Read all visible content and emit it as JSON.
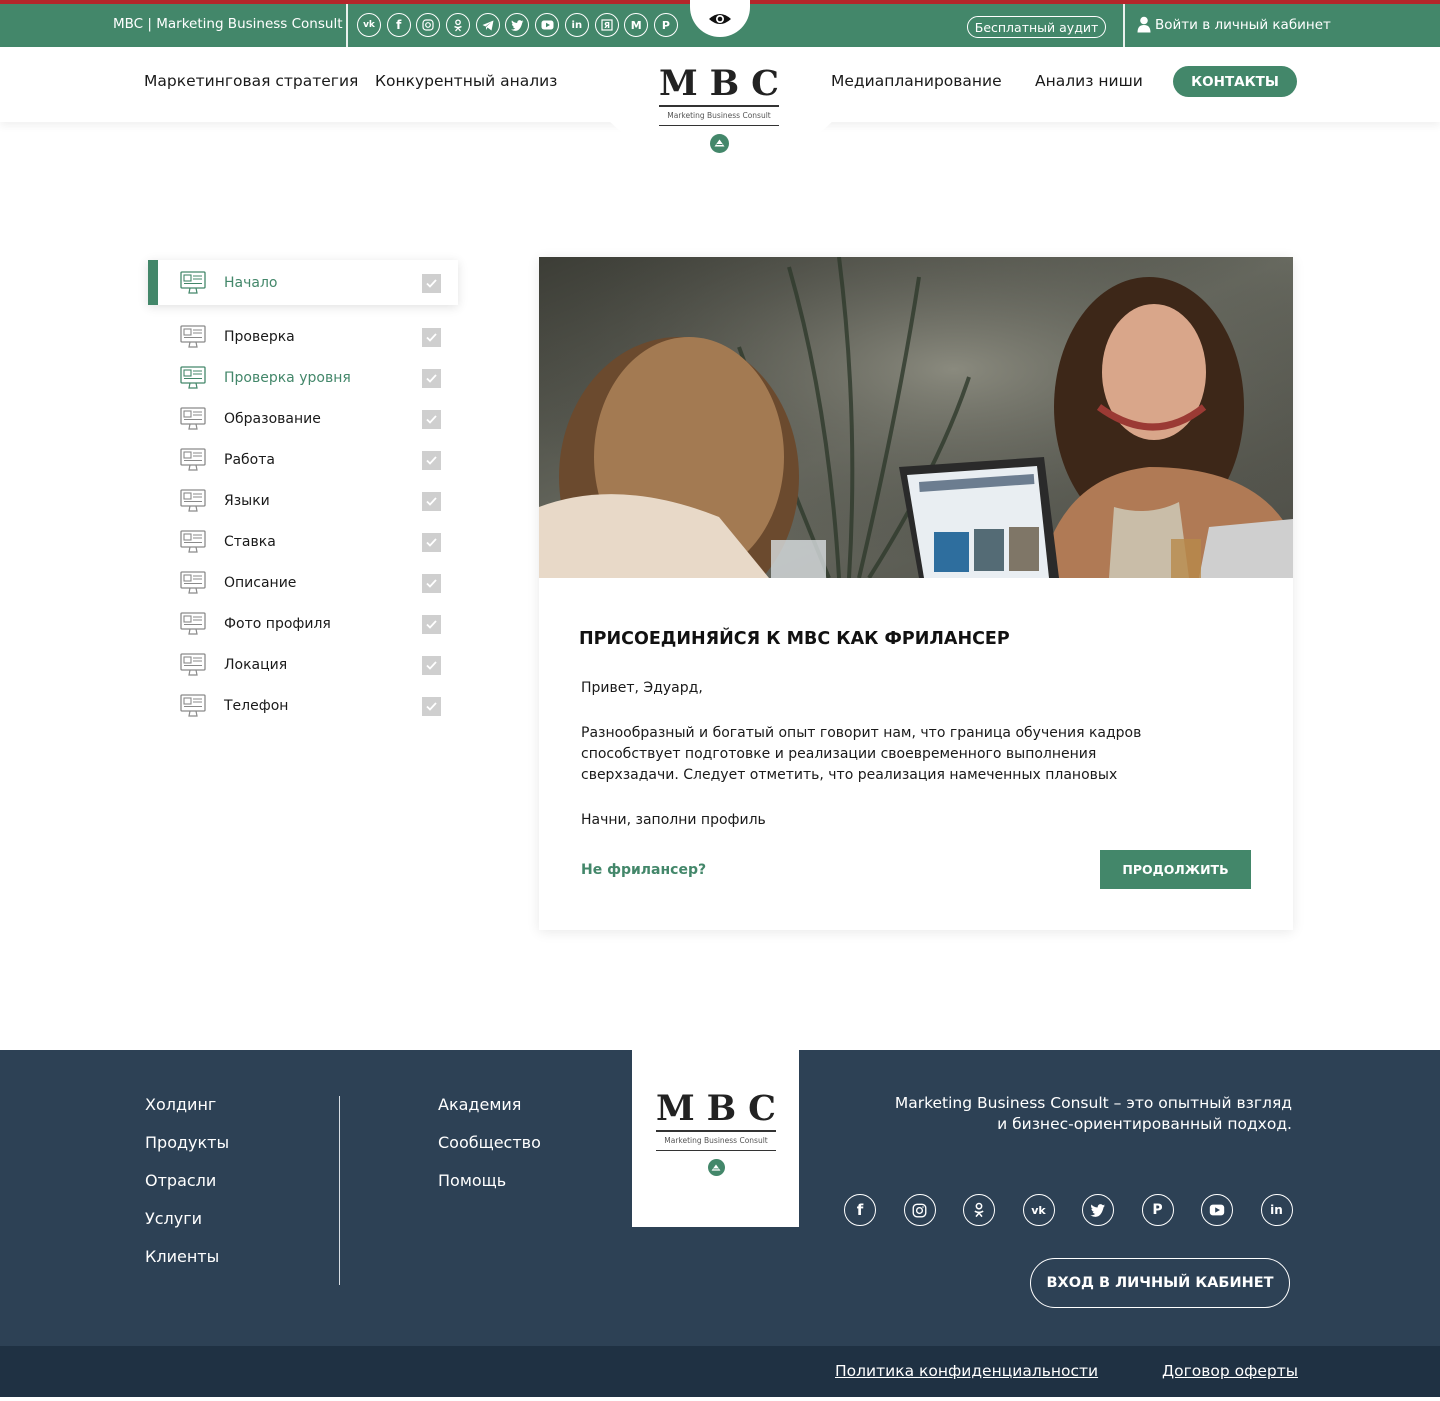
{
  "topbar": {
    "brand": "MBC | Marketing Business Consult",
    "socials": [
      "vk-icon",
      "facebook-icon",
      "instagram-icon",
      "odnoklassniki-icon",
      "telegram-icon",
      "twitter-icon",
      "youtube-icon",
      "linkedin-icon",
      "yandex-zen-icon",
      "medium-icon",
      "pinterest-icon"
    ],
    "audit": "Бесплатный аудит",
    "login": "Войти в личный кабинет"
  },
  "nav": {
    "left": [
      "Маркетинговая стратегия",
      "Конкурентный анализ"
    ],
    "right": [
      "Медиапланирование",
      "Анализ ниши"
    ],
    "contacts": "КОНТАКТЫ"
  },
  "logo": {
    "letters": [
      "M",
      "B",
      "C"
    ],
    "sub": "Marketing Business Consult"
  },
  "steps": [
    {
      "label": "Начало",
      "state": "active"
    },
    {
      "label": "Проверка",
      "state": "default"
    },
    {
      "label": "Проверка уровня",
      "state": "green"
    },
    {
      "label": "Образование",
      "state": "default"
    },
    {
      "label": "Работа",
      "state": "default"
    },
    {
      "label": "Языки",
      "state": "default"
    },
    {
      "label": "Ставка",
      "state": "default"
    },
    {
      "label": "Описание",
      "state": "default"
    },
    {
      "label": "Фото профиля",
      "state": "default"
    },
    {
      "label": "Локация",
      "state": "default"
    },
    {
      "label": "Телефон",
      "state": "default"
    }
  ],
  "card": {
    "title": "ПРИСОЕДИНЯЙСЯ К МВС КАК ФРИЛАНСЕР",
    "greeting": "Привет, Эдуард,",
    "body": "Разнообразный и богатый опыт говорит нам, что граница обучения кадров способствует подготовке и реализации своевременного выполнения сверхзадачи. Следует отметить, что реализация намеченных плановых",
    "cta_text": "Начни, заполни профиль",
    "not_freelancer": "Не фрилансер?",
    "continue": "ПРОДОЛЖИТЬ"
  },
  "footer": {
    "col1": [
      "Холдинг",
      "Продукты",
      "Отрасли",
      "Услуги",
      "Клиенты"
    ],
    "col2": [
      "Академия",
      "Сообщество",
      "Помощь"
    ],
    "description_line1": "Marketing Business Consult – это опытный взгляд",
    "description_line2": "и бизнес-ориентированный подход.",
    "socials": [
      "facebook-icon",
      "instagram-icon",
      "odnoklassniki-icon",
      "vk-icon",
      "twitter-icon",
      "pinterest-icon",
      "youtube-icon",
      "linkedin-icon"
    ],
    "login": "ВХОД В ЛИЧНЫЙ КАБИНЕТ",
    "privacy": "Политика конфиденциальности",
    "offer": "Договор оферты"
  },
  "colors": {
    "green": "#43876a",
    "red": "#b3262a",
    "footer": "#2d4155",
    "subfooter": "#1f3143"
  }
}
